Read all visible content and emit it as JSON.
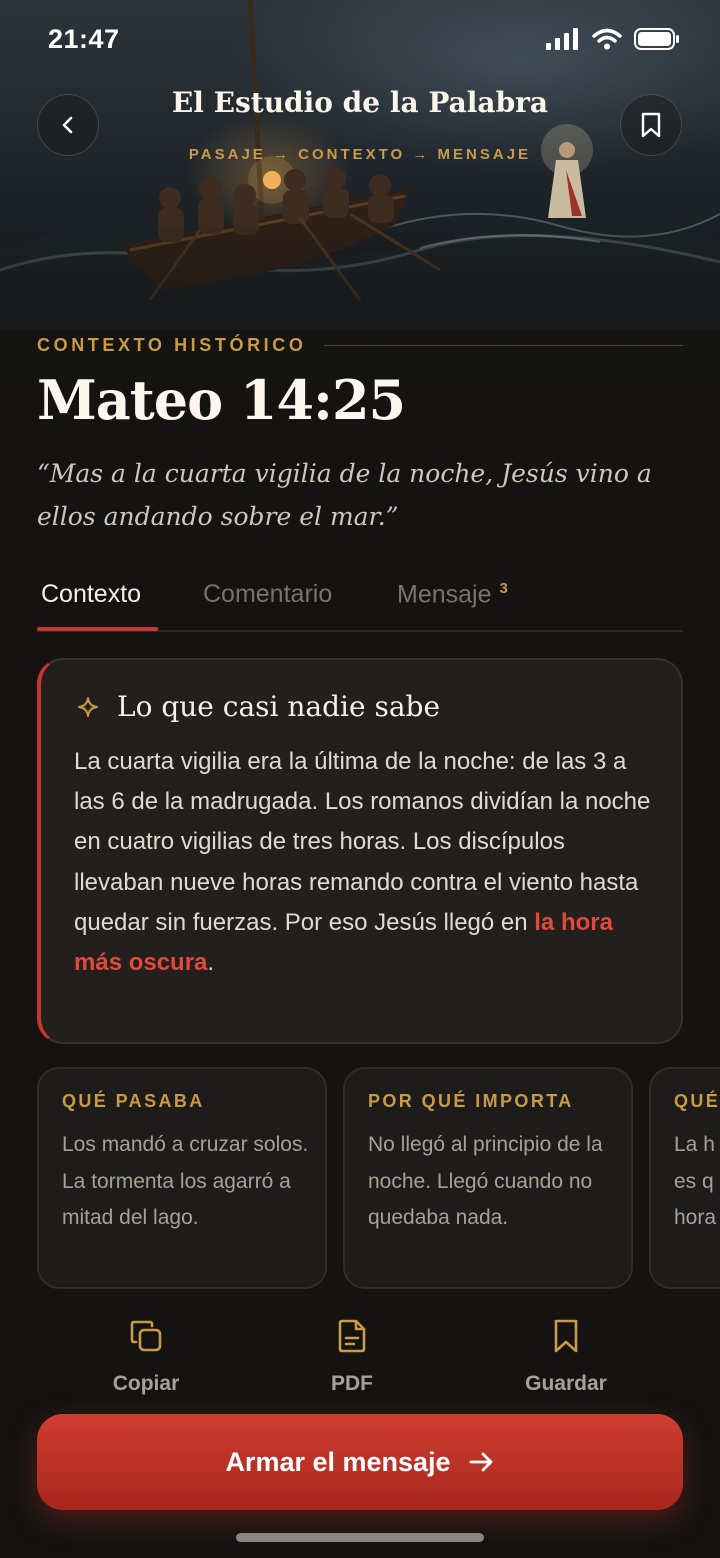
{
  "status_bar": {
    "time": "21:47"
  },
  "header": {
    "title": "El Estudio de la Palabra",
    "steps": "PASAJE → CONTEXTO → MENSAJE"
  },
  "section": {
    "eyebrow": "CONTEXTO HISTÓRICO",
    "title": "Mateo 14:25",
    "verse": "“Mas a la cuarta vigilia de la noche, Jesús vino a ellos andando sobre el mar.”"
  },
  "tabs": [
    {
      "label": "Contexto",
      "active": true
    },
    {
      "label": "Comentario",
      "active": false
    },
    {
      "label": "Mensaje",
      "badge": "3",
      "active": false
    }
  ],
  "insight": {
    "title": "Lo que casi nadie sabe",
    "body": "La cuarta vigilia era la última de la noche: de las 3 a las 6 de la madrugada. Los romanos dividían la noche en cuatro vigilias de tres horas. Los discípulos llevaban nueve horas remando contra el viento hasta quedar sin fuerzas. Por eso Jesús llegó en ",
    "highlight": "la hora más oscura",
    "end": "."
  },
  "cards": [
    {
      "label": "QUÉ PASABA",
      "text": "Los mandó a cruzar solos. La tormenta los agarró a mitad del lago."
    },
    {
      "label": "POR QUÉ IMPORTA",
      "text": "No llegó al principio de la noche. Llegó cuando no quedaba nada."
    },
    {
      "label": "QUÉ",
      "text": "La h es q hora"
    }
  ],
  "actions": [
    {
      "label": "Copiar",
      "icon": "copy-icon"
    },
    {
      "label": "PDF",
      "icon": "document-icon"
    },
    {
      "label": "Guardar",
      "icon": "bookmark-icon"
    }
  ],
  "cta": {
    "label": "Armar el mensaje"
  },
  "colors": {
    "accent_red": "#c9362c",
    "accent_gold": "#c99a47",
    "background": "#141312"
  }
}
